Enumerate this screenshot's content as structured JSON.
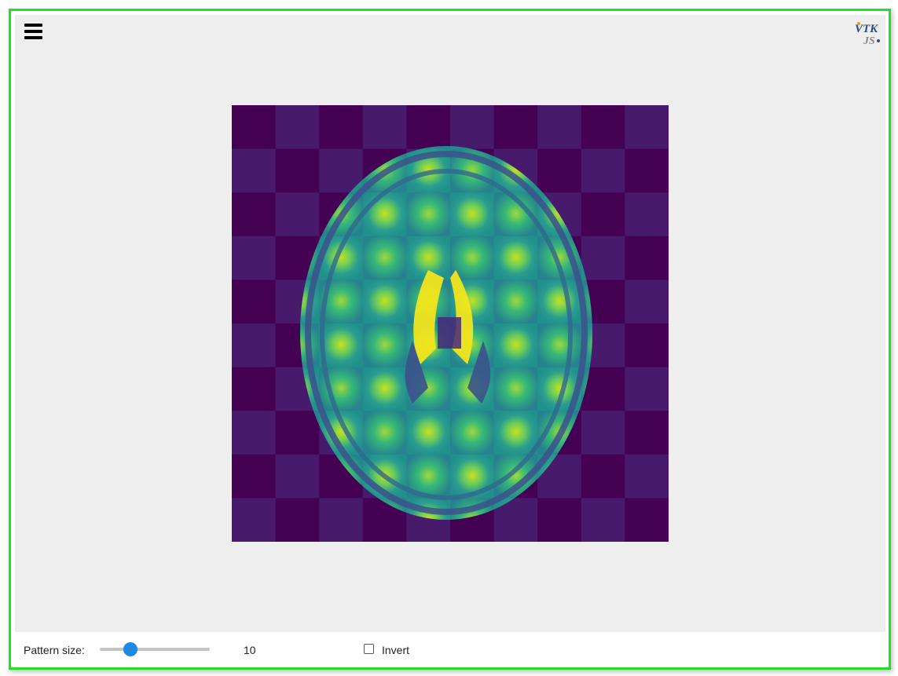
{
  "toolbar": {
    "menu_icon": "hamburger-menu-icon",
    "logo_line1": "VTK",
    "logo_line2": "JS"
  },
  "view": {
    "image_icon": "checkerboard-mri-image",
    "checker_tiles": 10,
    "colormap": "viridis",
    "colors": {
      "background": "#440154",
      "viewport": "#eeeeee",
      "frame_border": "#22e022"
    }
  },
  "controls": {
    "pattern_size_label": "Pattern size:",
    "pattern_size_value": "10",
    "pattern_size_fraction": 0.28,
    "slider_accent": "#1e88e5",
    "invert_label": "Invert",
    "invert_checked": false
  }
}
